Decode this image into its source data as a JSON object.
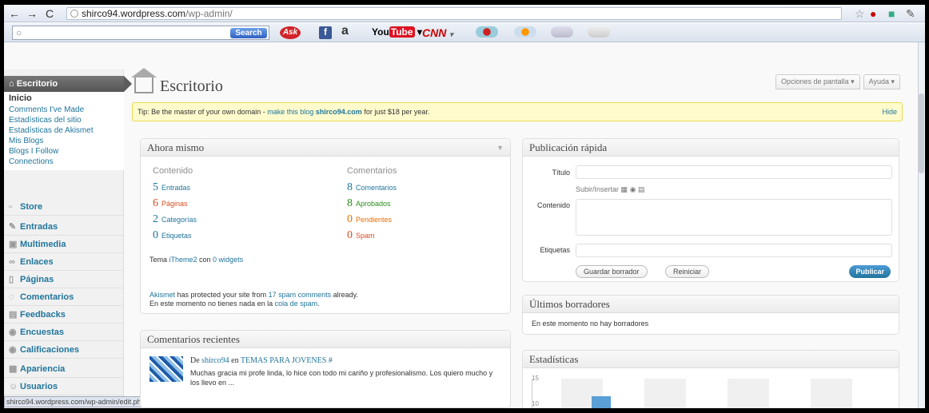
{
  "browser": {
    "url_host": "shirco94.wordpress.com",
    "url_path": "/wp-admin/",
    "status_url": "shirco94.wordpress.com/wp-admin/edit.php?post_type=page"
  },
  "toolbar": {
    "search_label": "Search",
    "ask": "Ask",
    "amazon": "a",
    "youtube_you": "You",
    "youtube_tube": "Tube",
    "cnn": "CNN"
  },
  "sidebar": {
    "title": "Escritorio",
    "sub": [
      "Inicio",
      "Comments I've Made",
      "Estadísticas del sitio",
      "Estadísticas de Akismet",
      "Mis Blogs",
      "Blogs I Follow",
      "Connections"
    ],
    "items": [
      "Store",
      "Entradas",
      "Multimedia",
      "Enlaces",
      "Páginas",
      "Comentarios",
      "Feedbacks",
      "Encuestas",
      "Calificaciones",
      "Apariencia",
      "Usuarios"
    ]
  },
  "header": {
    "title": "Escritorio",
    "screen_options": "Opciones de pantalla",
    "help": "Ayuda"
  },
  "tip": {
    "pre": "Tip: Be the master of your own domain - ",
    "link": "make this blog ",
    "domain": "shirco94.com",
    "post": " for just $18 per year.",
    "hide": "Hide"
  },
  "now": {
    "title": "Ahora mismo",
    "col1": "Contenido",
    "col2": "Comentarios",
    "content": [
      {
        "n": "5",
        "label": "Entradas"
      },
      {
        "n": "6",
        "label": "Páginas"
      },
      {
        "n": "2",
        "label": "Categorías"
      },
      {
        "n": "0",
        "label": "Etiquetas"
      }
    ],
    "comments": [
      {
        "n": "8",
        "label": "Comentarios"
      },
      {
        "n": "8",
        "label": "Aprobados"
      },
      {
        "n": "0",
        "label": "Pendientes"
      },
      {
        "n": "0",
        "label": "Spam"
      }
    ],
    "theme_pre": "Tema ",
    "theme": "iTheme2",
    "theme_mid": " con ",
    "widgets": "0 widgets",
    "akismet1_link": "Akismet",
    "akismet1_mid": " has protected your site from ",
    "akismet1_count": "17 spam comments",
    "akismet1_post": " already.",
    "akismet2_pre": "En este momento no tienes nada en la ",
    "akismet2_link": "cola de spam",
    "akismet2_post": "."
  },
  "recent": {
    "title": "Comentarios recientes",
    "de": "De ",
    "author": "shirco94",
    "en": " en ",
    "post": "TEMAS PARA JOVENES #",
    "body": "Muchas gracia mi profe linda, lo hice con todo mi cariño y profesionalismo. Los quiero mucho y los llevo en ..."
  },
  "quick": {
    "title": "Publicación rápida",
    "titulo": "Título",
    "upload": "Subir/Insertar",
    "contenido": "Contenido",
    "etiquetas": "Etiquetas",
    "save": "Guardar borrador",
    "reset": "Reiniciar",
    "publish": "Publicar"
  },
  "drafts": {
    "title": "Últimos borradores",
    "empty": "En este momento no hay borradores"
  },
  "stats": {
    "title": "Estadísticas",
    "tick_top": "15",
    "tick_bot": "10"
  },
  "colors": {
    "link": "#21759b",
    "tip_bg": "#fffbcc",
    "publish": "#21759b"
  }
}
